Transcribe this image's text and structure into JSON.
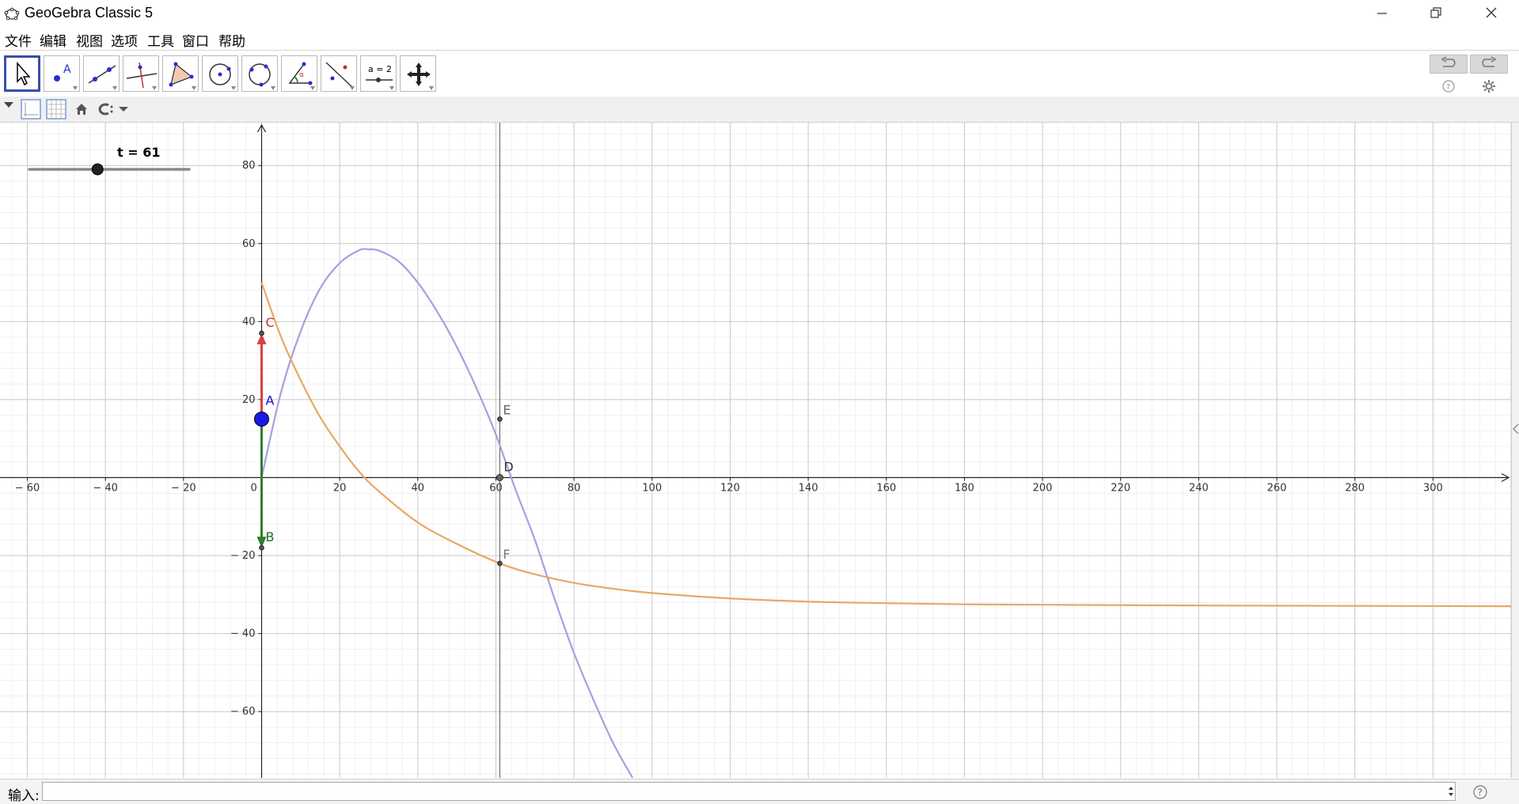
{
  "window": {
    "title": "GeoGebra Classic 5"
  },
  "menu": [
    "文件",
    "编辑",
    "视图",
    "选项",
    "工具",
    "窗口",
    "帮助"
  ],
  "toolbar": {
    "tools": [
      "move-tool",
      "point-tool",
      "line-tool",
      "perpendicular-tool",
      "polygon-tool",
      "circle-tool",
      "conic-tool",
      "angle-tool",
      "reflect-tool",
      "slider-tool",
      "move-view-tool"
    ],
    "slider_tool_text": "a = 2"
  },
  "slider": {
    "label": "t = 61",
    "min": 0,
    "max": 100,
    "value": 61
  },
  "axes": {
    "x_ticks": [
      "− 60",
      "− 40",
      "− 20",
      "0",
      "20",
      "40",
      "60",
      "80",
      "100",
      "120",
      "140",
      "160",
      "180",
      "200",
      "220",
      "240",
      "260",
      "280",
      "300"
    ],
    "y_ticks": [
      "80",
      "60",
      "40",
      "20",
      "− 20",
      "− 40",
      "− 60"
    ]
  },
  "chart_data": {
    "type": "line",
    "view": {
      "xlim": [
        -67,
        320
      ],
      "ylim": [
        -77,
        91
      ],
      "grid": true
    },
    "series": [
      {
        "color": "#a89fe0",
        "x": [
          0,
          5,
          10,
          15,
          20,
          25,
          27.5,
          30,
          35,
          40,
          45,
          50,
          55,
          60,
          61,
          65,
          70,
          75,
          80,
          85,
          90,
          95
        ],
        "y": [
          0,
          22,
          37.5,
          48.5,
          55,
          58.3,
          58.5,
          58.2,
          55.5,
          50,
          42.5,
          33.5,
          23,
          11,
          15.2,
          -3,
          -16,
          -31,
          -45,
          -57,
          -68,
          -77
        ]
      },
      {
        "color": "#e8a865",
        "x": [
          0,
          5,
          10,
          15,
          20,
          25,
          30,
          40,
          50,
          61,
          70,
          80,
          90,
          100,
          120,
          140,
          160,
          180,
          200,
          240,
          280,
          320
        ],
        "y": [
          50,
          36,
          25,
          15.5,
          8,
          1.5,
          -3.5,
          -11.5,
          -17,
          -22,
          -24.8,
          -27,
          -28.5,
          -29.6,
          -31,
          -31.8,
          -32.2,
          -32.5,
          -32.6,
          -32.8,
          -32.9,
          -33
        ]
      }
    ],
    "points": [
      {
        "name": "A",
        "x": 0,
        "y": 15,
        "color": "#1010e0"
      },
      {
        "name": "B",
        "x": 0,
        "y": -18,
        "color": "#1e6f1e"
      },
      {
        "name": "C",
        "x": 0,
        "y": 37,
        "color": "#c03030"
      },
      {
        "name": "D",
        "x": 61,
        "y": 0,
        "color": "#333333"
      },
      {
        "name": "E",
        "x": 61,
        "y": 15,
        "color": "#666666"
      },
      {
        "name": "F",
        "x": 61,
        "y": -22,
        "color": "#777777"
      }
    ],
    "vectors": [
      {
        "from": [
          0,
          15
        ],
        "to": [
          0,
          37
        ],
        "color": "#d94040"
      },
      {
        "from": [
          0,
          15
        ],
        "to": [
          0,
          -18
        ],
        "color": "#2f7f2f"
      }
    ],
    "vertical_line_x": 61
  },
  "input": {
    "label": "输入:",
    "value": ""
  }
}
